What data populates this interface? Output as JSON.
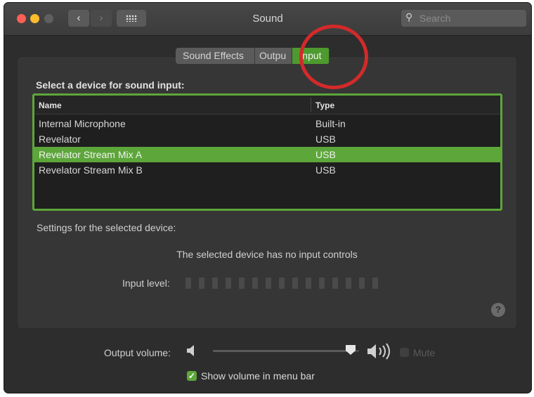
{
  "window": {
    "title": "Sound"
  },
  "toolbar": {
    "back_glyph": "‹",
    "forward_glyph": "›",
    "search_placeholder": "Search",
    "search_icon": "magnifier-icon"
  },
  "tabs": [
    {
      "label": "Sound Effects",
      "selected": false
    },
    {
      "label": "Output",
      "visible_text": "Outpu",
      "selected": false
    },
    {
      "label": "Input",
      "selected": true
    }
  ],
  "input": {
    "section_label": "Select a device for sound input:",
    "columns": [
      "Name",
      "Type"
    ],
    "devices": [
      {
        "name": "Internal Microphone",
        "type": "Built-in",
        "selected": false
      },
      {
        "name": "Revelator",
        "type": "USB",
        "selected": false
      },
      {
        "name": "Revelator Stream Mix A",
        "type": "USB",
        "selected": true
      },
      {
        "name": "Revelator Stream Mix B",
        "type": "USB",
        "selected": false
      }
    ],
    "settings_label": "Settings for the selected device:",
    "no_controls_text": "The selected device has no input controls",
    "input_level_label": "Input level:",
    "input_level_segments": 15,
    "input_level_value": 0
  },
  "help_glyph": "?",
  "output": {
    "volume_label": "Output volume:",
    "volume_fraction": 0.95,
    "mute_label": "Mute",
    "mute_checked": false,
    "show_in_menubar_label": "Show volume in menu bar",
    "show_in_menubar_checked": true,
    "check_glyph": "✓"
  },
  "colors": {
    "accent_green": "#5da63a",
    "annotation_red": "#d32a2a",
    "window_bg": "#2d2d2d"
  }
}
